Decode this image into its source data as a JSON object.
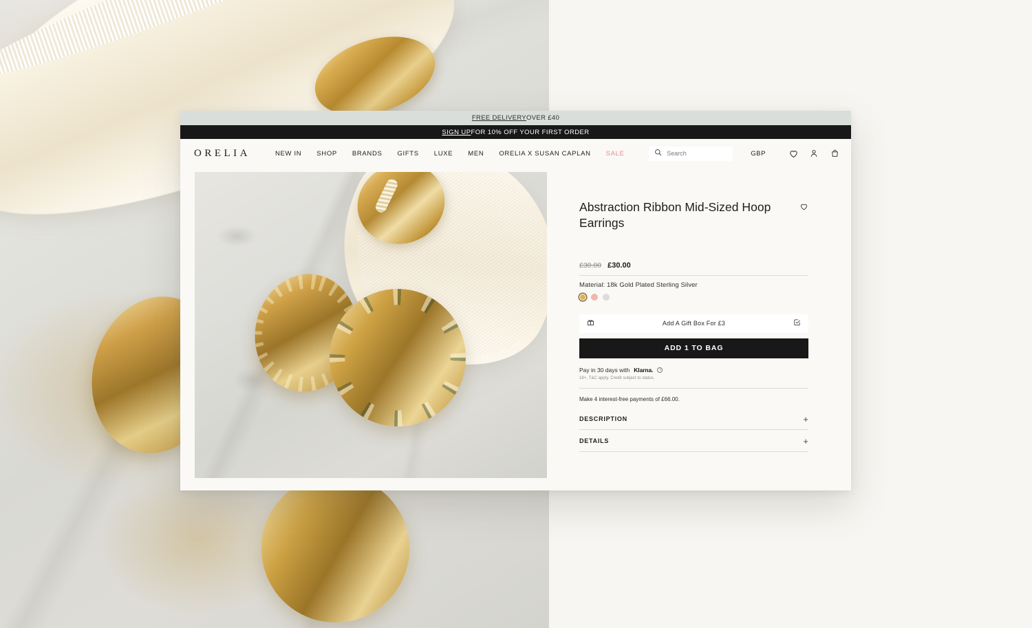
{
  "promo": {
    "top_link": "FREE DELIVERY",
    "top_rest": " OVER £40",
    "dark_link": "SIGN UP",
    "dark_rest": " FOR 10% OFF YOUR FIRST ORDER"
  },
  "header": {
    "logo": "ORELIA",
    "nav": [
      {
        "label": "NEW IN",
        "name": "nav-new-in",
        "sale": false
      },
      {
        "label": "SHOP",
        "name": "nav-shop",
        "sale": false
      },
      {
        "label": "BRANDS",
        "name": "nav-brands",
        "sale": false
      },
      {
        "label": "GIFTS",
        "name": "nav-gifts",
        "sale": false
      },
      {
        "label": "LUXE",
        "name": "nav-luxe",
        "sale": false
      },
      {
        "label": "MEN",
        "name": "nav-men",
        "sale": false
      },
      {
        "label": "ORELIA X SUSAN CAPLAN",
        "name": "nav-orelia-x-susan-caplan",
        "sale": false
      },
      {
        "label": "SALE",
        "name": "nav-sale",
        "sale": true
      }
    ],
    "search_placeholder": "Search",
    "search_value": "",
    "currency": "GBP",
    "icons": {
      "search": "search-icon",
      "wishlist": "heart-icon",
      "account": "user-icon",
      "bag": "shopping-bag-icon"
    }
  },
  "product": {
    "title": "Abstraction Ribbon Mid-Sized Hoop Earrings",
    "price_old": "£30.00",
    "price_now": "£30.00",
    "material": "Material: 18k Gold Plated Sterling Silver",
    "swatches": [
      {
        "name": "swatch-gold",
        "color": "#d8b25f",
        "selected": true
      },
      {
        "name": "swatch-rose-gold",
        "color": "#f0b7ac",
        "selected": false
      },
      {
        "name": "swatch-silver",
        "color": "#dcdcdc",
        "selected": false
      }
    ],
    "gift_box_label": "Add A Gift Box For £3",
    "add_to_bag_label": "ADD 1 TO BAG",
    "klarna_prefix": "Pay in 30 days with",
    "klarna_brand": "Klarna.",
    "klarna_fine": "18+, T&C apply. Credit subject to status.",
    "payments_note": "Make 4 interest-free payments of £66.00.",
    "accordions": [
      {
        "label": "DESCRIPTION",
        "name": "accordion-description",
        "toggle": "+"
      },
      {
        "label": "DETAILS",
        "name": "accordion-details",
        "toggle": "+"
      }
    ]
  },
  "colors": {
    "promo_bar": "#dadedb",
    "promo_dark": "#181818",
    "page_bg": "#f7f6f2",
    "card_bg": "#faf9f6",
    "sale_accent": "#e98c8c",
    "cta_bg": "#181818"
  }
}
